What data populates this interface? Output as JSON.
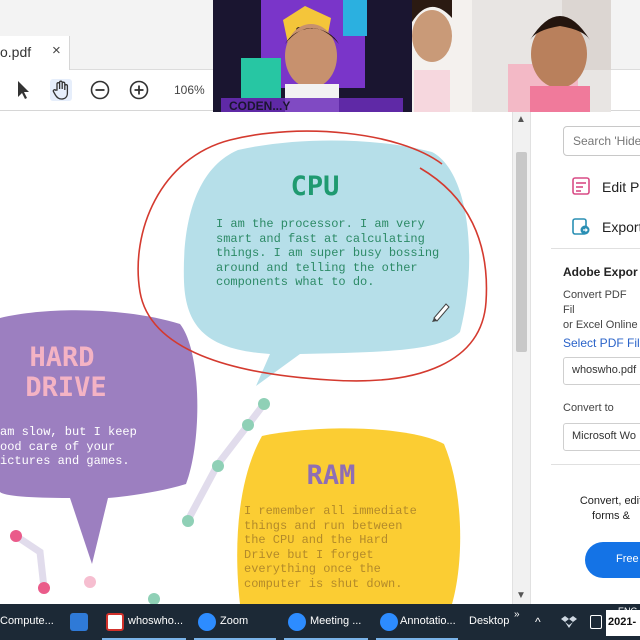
{
  "tab": {
    "label": "o.pdf",
    "close": "×"
  },
  "toolbar": {
    "zoom": "106%"
  },
  "document": {
    "cpu": {
      "title": "CPU",
      "body": "I am the processor. I am very\nsmart and fast at calculating\nthings. I am super busy bossing\naround and telling the other\ncomponents what to do."
    },
    "hard_drive": {
      "title_line1": "HARD",
      "title_line2": "DRIVE",
      "body": " am slow, but I keep\nood care of your\nictures and games."
    },
    "ram": {
      "title": "RAM",
      "body": "I remember all immediate\nthings and run between\nthe CPU and the Hard\nDrive but I forget\neverything once the\ncomputer is shut down."
    },
    "colors": {
      "cpu_bubble": "#b6dfe9",
      "cpu_title": "#1f9a70",
      "hd_bubble": "#9c7fc0",
      "hd_title": "#f4b3c4",
      "ram_bubble": "#fbcd33",
      "ram_title": "#8f6eb4",
      "annotation": "#d43a2f"
    }
  },
  "video": {
    "tile1_banner": "CODEN...Y"
  },
  "right_pane": {
    "search_placeholder": "Search 'Hide",
    "edit_pdf": "Edit PD",
    "export": "Export",
    "heading": "Adobe Expor",
    "description": "Convert PDF Fil\nor Excel Online",
    "select_label": "Select PDF File",
    "file_value": "whoswho.pdf",
    "convert_to_label": "Convert to",
    "format_value": "Microsoft Wo",
    "promo": "Convert, edit\nforms &",
    "free_button": "Free"
  },
  "taskbar": {
    "items": [
      {
        "label": "Compute..."
      },
      {
        "label": ""
      },
      {
        "label": "whoswho..."
      },
      {
        "label": "Zoom"
      },
      {
        "label": "Meeting ..."
      },
      {
        "label": "Annotatio..."
      }
    ],
    "desktop": "Desktop",
    "lang": "ENG",
    "clock": "2021-"
  }
}
